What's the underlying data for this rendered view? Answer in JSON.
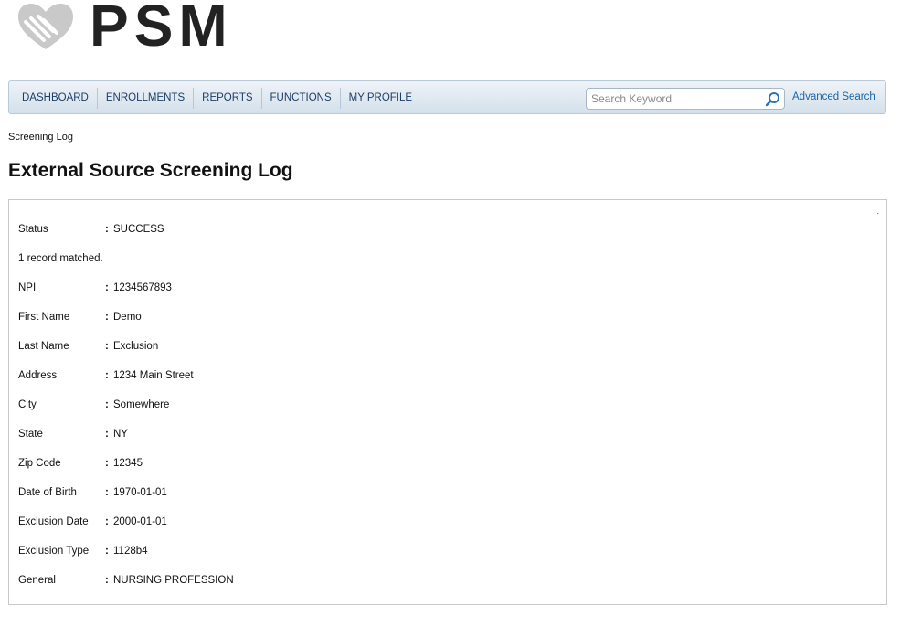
{
  "brand": {
    "logo_text": "PSM"
  },
  "nav": {
    "items": [
      {
        "label": "DASHBOARD"
      },
      {
        "label": "ENROLLMENTS"
      },
      {
        "label": "REPORTS"
      },
      {
        "label": "FUNCTIONS"
      },
      {
        "label": "MY PROFILE"
      }
    ],
    "search_placeholder": "Search Keyword",
    "search_value": "",
    "advanced_search_label": "Advanced Search"
  },
  "breadcrumb": "Screening Log",
  "page_title": "External Source Screening Log",
  "panel": {
    "corner_mark": ".",
    "status": {
      "label": "Status",
      "value": "SUCCESS"
    },
    "record_count_text": "1 record matched.",
    "fields": [
      {
        "label": "NPI",
        "value": "1234567893"
      },
      {
        "label": "First Name",
        "value": "Demo"
      },
      {
        "label": "Last Name",
        "value": "Exclusion"
      },
      {
        "label": "Address",
        "value": "1234 Main Street"
      },
      {
        "label": "City",
        "value": "Somewhere"
      },
      {
        "label": "State",
        "value": "NY"
      },
      {
        "label": "Zip Code",
        "value": "12345"
      },
      {
        "label": "Date of Birth",
        "value": "1970-01-01"
      },
      {
        "label": "Exclusion Date",
        "value": "2000-01-01"
      },
      {
        "label": "Exclusion Type",
        "value": "1128b4"
      },
      {
        "label": "General",
        "value": "NURSING PROFESSION"
      }
    ],
    "separator": ":"
  }
}
